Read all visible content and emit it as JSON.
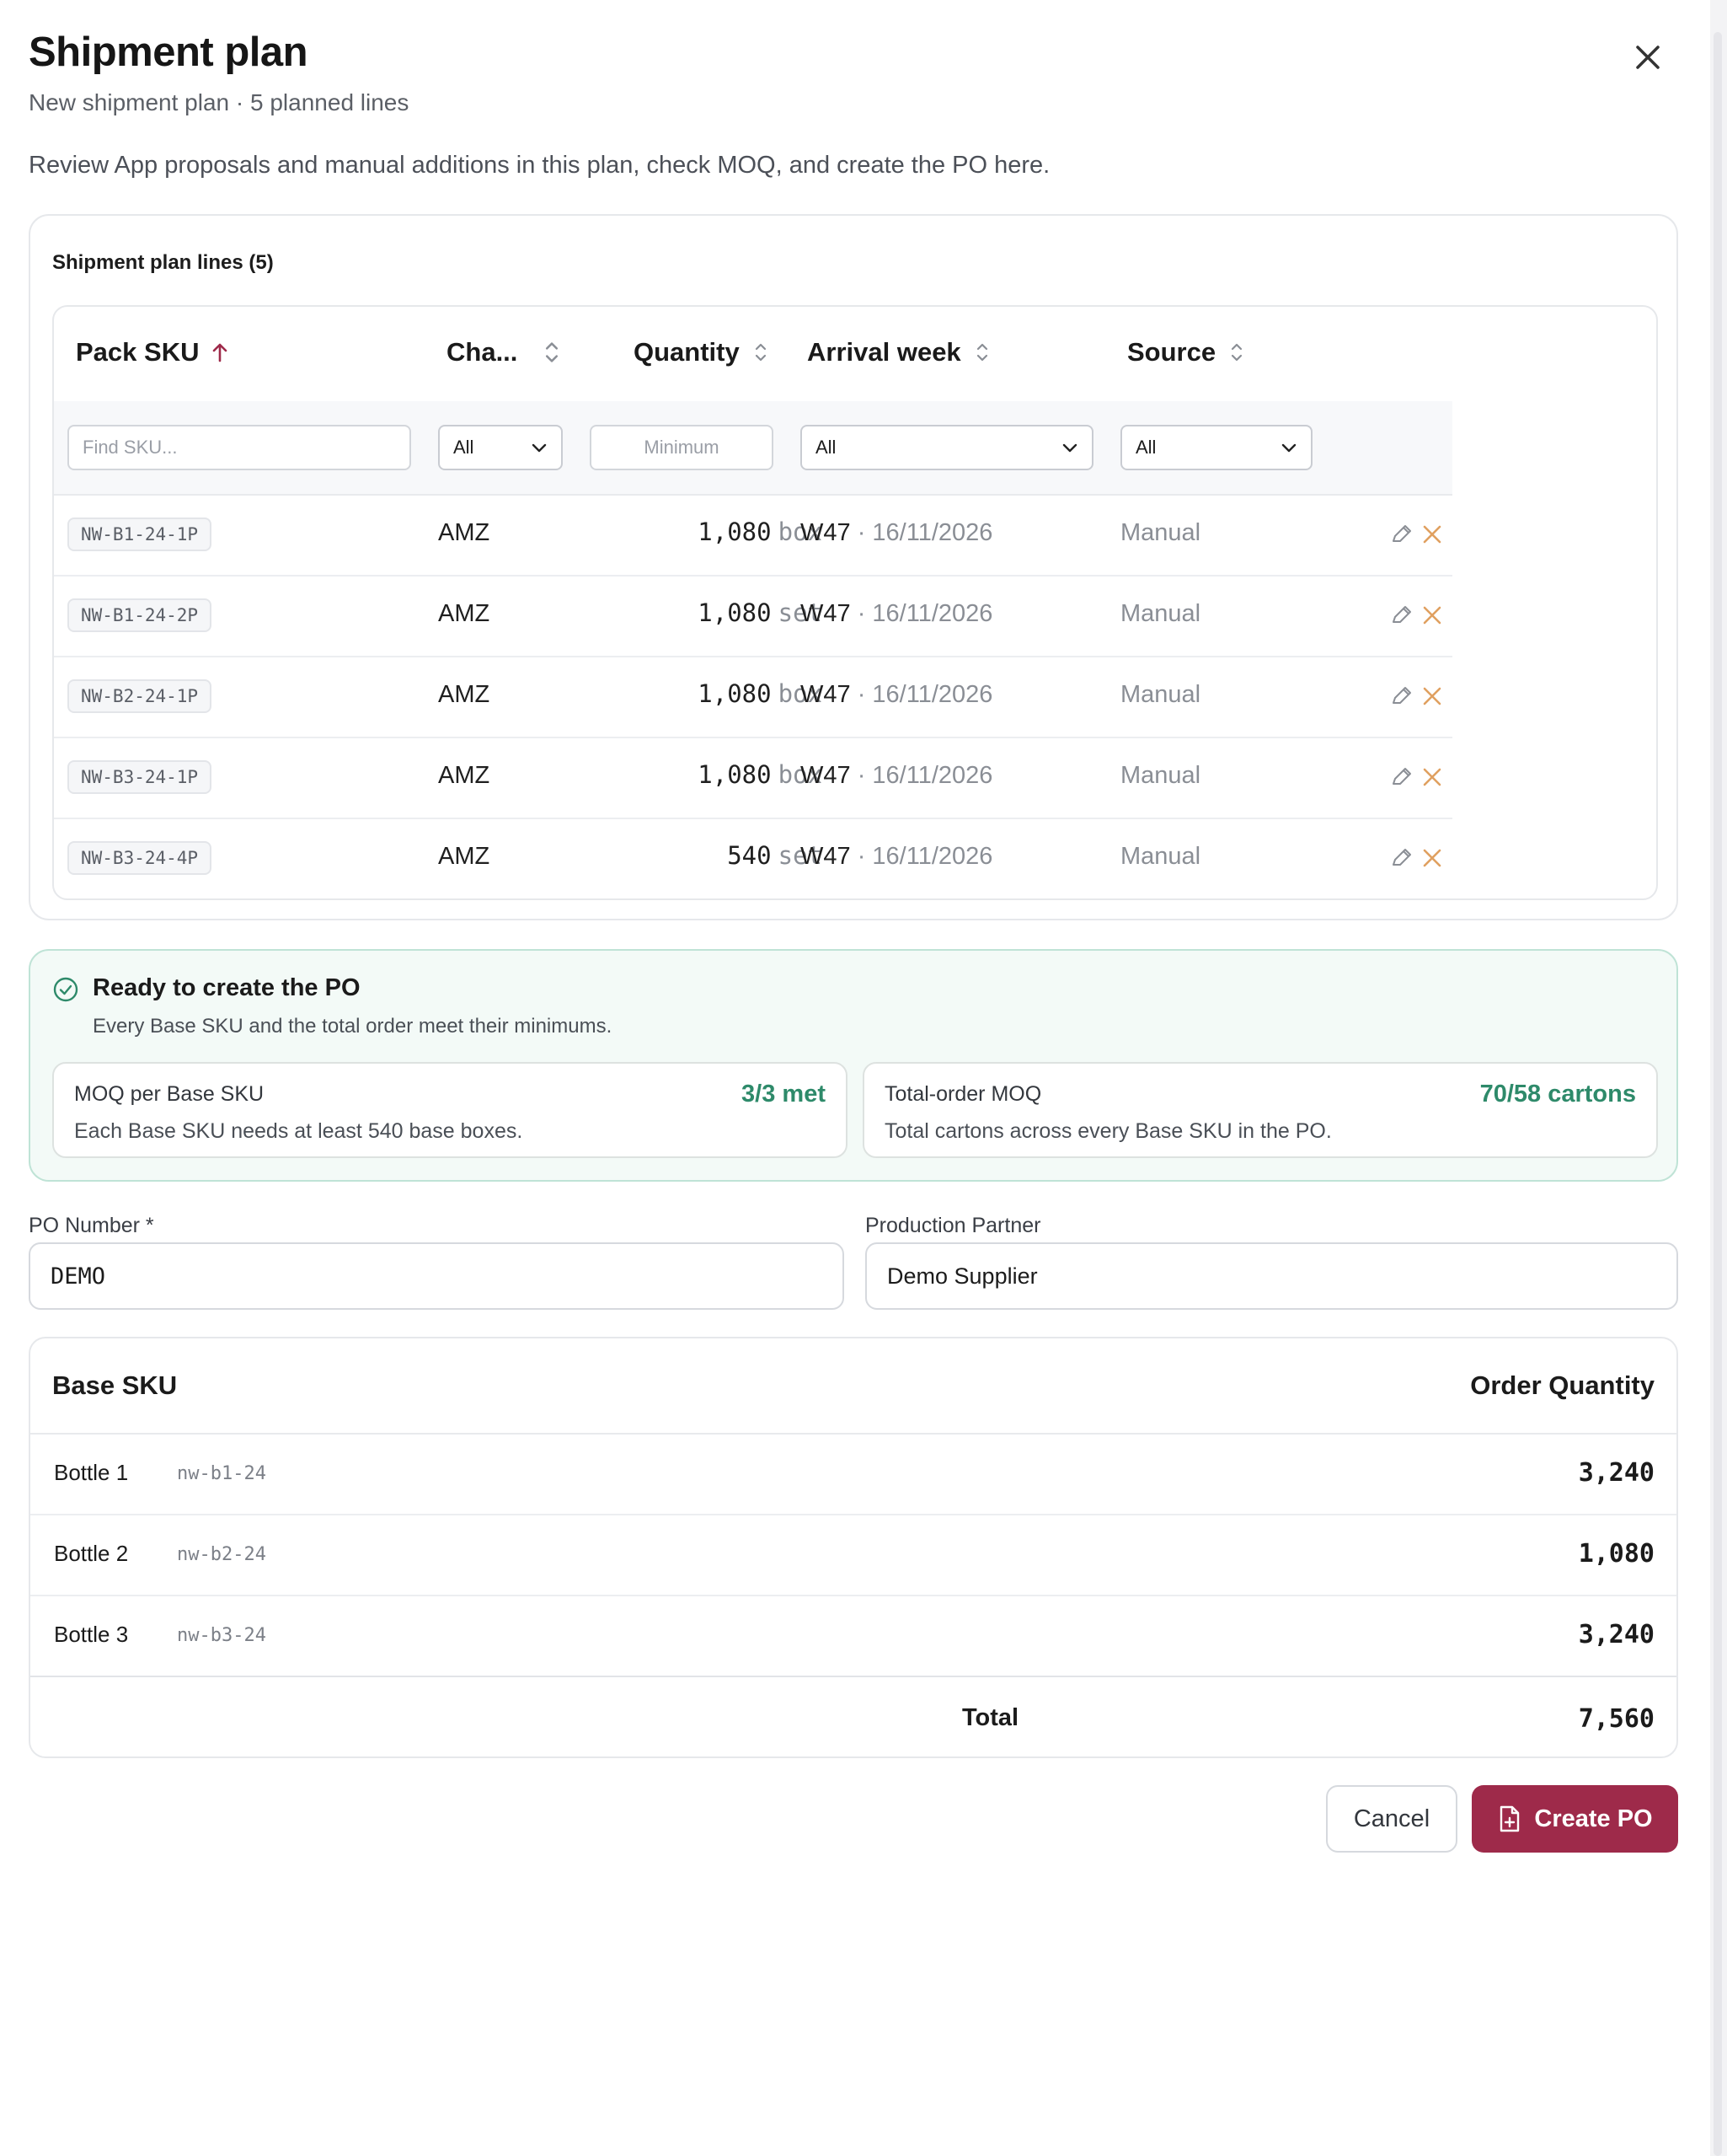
{
  "header": {
    "title": "Shipment plan",
    "subtitle": "New shipment plan · 5 planned lines",
    "intro": "Review App proposals and manual additions in this plan, check MOQ, and create the PO here."
  },
  "lines_card": {
    "title": "Shipment plan lines (5)",
    "columns": {
      "pack_sku": "Pack SKU",
      "channel": "Cha...",
      "quantity": "Quantity",
      "arrival_week": "Arrival week",
      "source": "Source"
    },
    "filters": {
      "sku_placeholder": "Find SKU...",
      "channel_value": "All",
      "quantity_placeholder": "Minimum",
      "week_value": "All",
      "source_value": "All"
    },
    "rows": [
      {
        "sku": "NW-B1-24-1P",
        "channel": "AMZ",
        "qty": "1,080",
        "unit": "box",
        "week": "W47",
        "date": "· 16/11/2026",
        "source": "Manual"
      },
      {
        "sku": "NW-B1-24-2P",
        "channel": "AMZ",
        "qty": "1,080",
        "unit": "set",
        "week": "W47",
        "date": "· 16/11/2026",
        "source": "Manual"
      },
      {
        "sku": "NW-B2-24-1P",
        "channel": "AMZ",
        "qty": "1,080",
        "unit": "box",
        "week": "W47",
        "date": "· 16/11/2026",
        "source": "Manual"
      },
      {
        "sku": "NW-B3-24-1P",
        "channel": "AMZ",
        "qty": "1,080",
        "unit": "box",
        "week": "W47",
        "date": "· 16/11/2026",
        "source": "Manual"
      },
      {
        "sku": "NW-B3-24-4P",
        "channel": "AMZ",
        "qty": "540",
        "unit": "set",
        "week": "W47",
        "date": "· 16/11/2026",
        "source": "Manual"
      }
    ]
  },
  "ready": {
    "title": "Ready to create the PO",
    "subtitle": "Every Base SKU and the total order meet their minimums.",
    "moq_base": {
      "label": "MOQ per Base SKU",
      "value": "3/3 met",
      "desc": "Each Base SKU needs at least 540 base boxes."
    },
    "moq_total": {
      "label": "Total-order MOQ",
      "value": "70/58 cartons",
      "desc": "Total cartons across every Base SKU in the PO."
    }
  },
  "form": {
    "po_label": "PO Number *",
    "po_value": "DEMO",
    "partner_label": "Production Partner",
    "partner_value": "Demo Supplier"
  },
  "base_table": {
    "col_base": "Base SKU",
    "col_qty": "Order Quantity",
    "rows": [
      {
        "name": "Bottle 1",
        "code": "nw-b1-24",
        "qty": "3,240"
      },
      {
        "name": "Bottle 2",
        "code": "nw-b2-24",
        "qty": "1,080"
      },
      {
        "name": "Bottle 3",
        "code": "nw-b3-24",
        "qty": "3,240"
      }
    ],
    "total_label": "Total",
    "total_value": "7,560"
  },
  "actions": {
    "cancel": "Cancel",
    "create": "Create PO"
  },
  "colors": {
    "accent": "#9e2a4a",
    "success": "#2e8a6a",
    "delete": "#e0a060"
  }
}
